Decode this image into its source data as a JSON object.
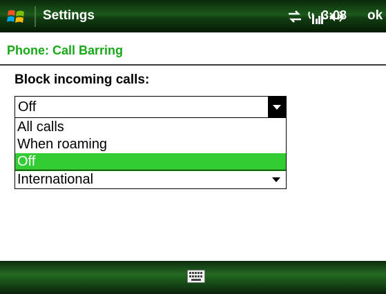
{
  "titlebar": {
    "app_title": "Settings",
    "clock": "3:08",
    "ok_label": "ok"
  },
  "header": {
    "page_title": "Phone: Call Barring"
  },
  "form": {
    "label": "Block incoming calls:",
    "selected_value": "Off",
    "options": [
      "All calls",
      "When roaming",
      "Off",
      "International"
    ],
    "highlighted_option": "Off"
  },
  "colors": {
    "accent_green": "#18a818",
    "highlight_green": "#33cc33",
    "bar_dark_green": "#1c5a1c"
  },
  "icons": {
    "start": "windows-flag-icon",
    "connectivity": "sync-arrows-icon",
    "signal": "signal-strength-icon",
    "volume": "speaker-volume-icon",
    "keyboard": "keyboard-icon"
  }
}
